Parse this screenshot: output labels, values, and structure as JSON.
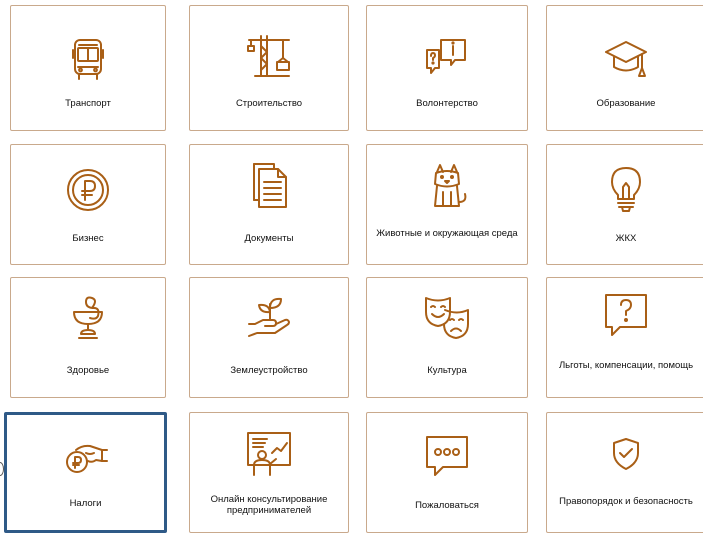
{
  "accent_color": "#a95f16",
  "selection_color": "#2f5a87",
  "tiles": [
    {
      "label": "Транспорт",
      "icon": "bus-icon"
    },
    {
      "label": "Строительство",
      "icon": "crane-icon"
    },
    {
      "label": "Волонтерство",
      "icon": "chat-question-info-icon"
    },
    {
      "label": "Образование",
      "icon": "graduation-cap-icon"
    },
    {
      "label": "Бизнес",
      "icon": "ruble-coin-icon"
    },
    {
      "label": "Документы",
      "icon": "documents-icon"
    },
    {
      "label": "Животные и окружающая среда",
      "icon": "dog-icon"
    },
    {
      "label": "ЖКХ",
      "icon": "light-bulb-icon"
    },
    {
      "label": "Здоровье",
      "icon": "bowl-of-hygieia-icon"
    },
    {
      "label": "Землеустройство",
      "icon": "hand-sprout-icon"
    },
    {
      "label": "Культура",
      "icon": "theater-masks-icon"
    },
    {
      "label": "Льготы, компенсации, помощь",
      "icon": "question-bubble-icon"
    },
    {
      "label": "Налоги",
      "icon": "hand-ruble-coin-icon",
      "selected": true
    },
    {
      "label": "Онлайн консультирование предпринимателей",
      "icon": "presenter-board-icon"
    },
    {
      "label": "Пожаловаться",
      "icon": "ellipsis-bubble-icon"
    },
    {
      "label": "Правопорядок и безопасность",
      "icon": "shield-check-icon"
    }
  ]
}
